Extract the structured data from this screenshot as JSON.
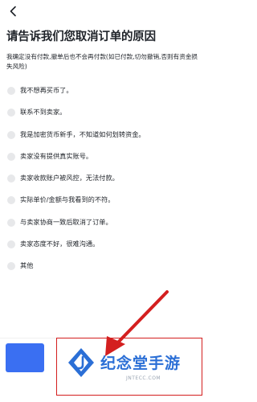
{
  "page": {
    "title": "请告诉我们您取消订单的原因",
    "notice": "我确定没有付款,撤单后也不会再付款(如已付款,切勿撤销,否则有资金损失风险)"
  },
  "reasons": [
    {
      "label": "我不想再买币了。"
    },
    {
      "label": "联系不到卖家。"
    },
    {
      "label": "我是加密货币新手，不知道如何划转资金。"
    },
    {
      "label": "卖家没有提供真实账号。"
    },
    {
      "label": "卖家收款账户被风控，无法付款。"
    },
    {
      "label": "实际单价/金额与我看到的不符。"
    },
    {
      "label": "与卖家协商一致后取消了订单。"
    },
    {
      "label": "卖家态度不好，很难沟通。"
    },
    {
      "label": "其他"
    }
  ],
  "watermark": {
    "brand": "纪念堂手游",
    "url": "JNTECC.COM"
  },
  "colors": {
    "accent": "#3a6ff2",
    "radio": "#e7e8ea",
    "annotation": "#d41f1f",
    "brand": "#2b6fd6"
  },
  "icons": {
    "back": "chevron-left-icon",
    "radio": "radio-unchecked-icon"
  }
}
